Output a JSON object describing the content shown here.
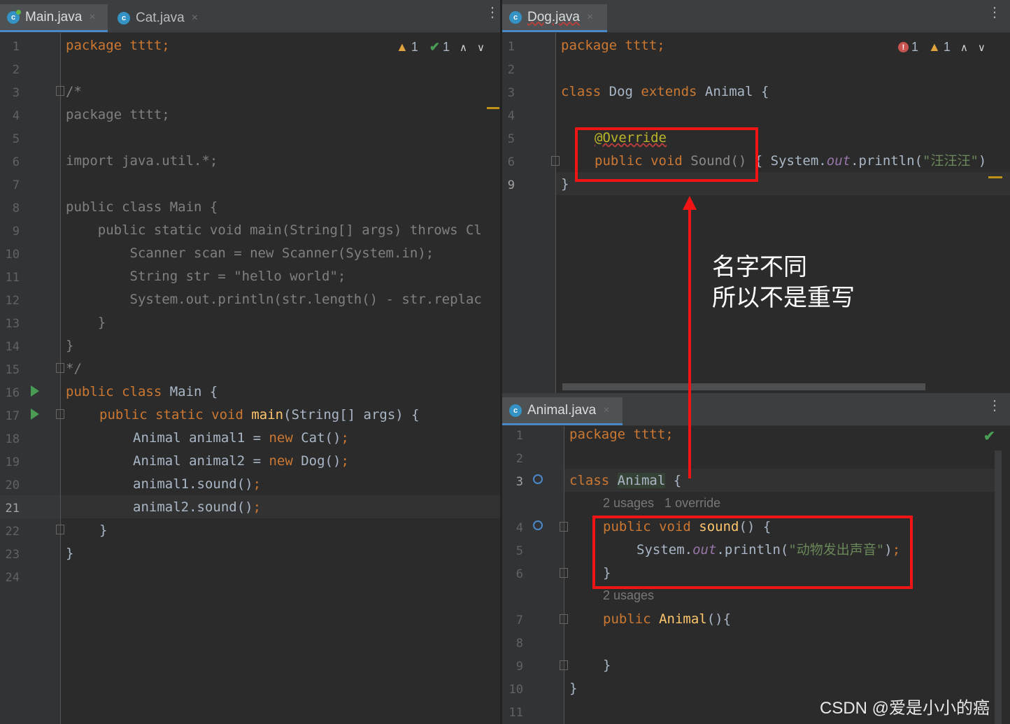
{
  "left_pane": {
    "tabs": [
      {
        "label": "Main.java",
        "close": "×"
      },
      {
        "label": "Cat.java",
        "close": "×"
      }
    ],
    "status": {
      "warnings": "1",
      "checks": "1"
    },
    "line_numbers": [
      "1",
      "2",
      "3",
      "4",
      "5",
      "6",
      "7",
      "8",
      "9",
      "10",
      "11",
      "12",
      "13",
      "14",
      "15",
      "16",
      "17",
      "18",
      "19",
      "20",
      "21",
      "22",
      "23",
      "24"
    ],
    "lines": {
      "l1_kw": "package",
      "l1_rest": " tttt;",
      "l3": "/*",
      "l4": "package tttt;",
      "l6": "import java.util.*;",
      "l8": "public class Main {",
      "l9": "    public static void main(String[] args) throws Cl",
      "l10": "        Scanner scan = new Scanner(System.in);",
      "l11": "        String str = \"hello world\";",
      "l12": "        System.out.println(str.length() - str.replac",
      "l13": "    }",
      "l14": "}",
      "l15": "*/",
      "l16_kw": "public class",
      "l16_rest": " Main {",
      "l17_kw": "public static void",
      "l17_fn": "main",
      "l17_rest": "(String[] args) {",
      "l18_a": "Animal animal1 = ",
      "l18_kw": "new",
      "l18_b": " Cat()",
      "l18_semi": ";",
      "l19_a": "Animal animal2 = ",
      "l19_kw": "new",
      "l19_b": " Dog()",
      "l19_semi": ";",
      "l20_a": "animal1.sound()",
      "l20_semi": ";",
      "l21_a": "animal2.sound()",
      "l21_semi": ";",
      "l22": "}",
      "l23": "}"
    }
  },
  "dog_pane": {
    "tab": {
      "label": "Dog.java",
      "close": "×"
    },
    "status": {
      "errors": "1",
      "warnings": "1"
    },
    "line_numbers": [
      "1",
      "2",
      "3",
      "4",
      "5",
      "6",
      "9"
    ],
    "lines": {
      "l1_kw": "package",
      "l1_rest": " tttt;",
      "l3_kw1": "class",
      "l3_a": " Dog ",
      "l3_kw2": "extends",
      "l3_b": " Animal {",
      "l5": "@Override",
      "l6_kw": "public void",
      "l6_a": " Sound()",
      "l6_b": " { System.",
      "l6_out": "out",
      "l6_c": ".println(",
      "l6_str": "\"汪汪汪\"",
      "l6_d": ")",
      "l9": "}"
    }
  },
  "animal_pane": {
    "tab": {
      "label": "Animal.java",
      "close": "×"
    },
    "line_numbers": [
      "1",
      "2",
      "3",
      "4",
      "5",
      "6",
      "7",
      "8",
      "9",
      "10",
      "11"
    ],
    "hints": {
      "h1": "2 usages   1 override",
      "h2": "2 usages"
    },
    "lines": {
      "l1_kw": "package",
      "l1_rest": " tttt;",
      "l3_kw": "class",
      "l3_name": "Animal",
      "l3_rest": " {",
      "l4_kw": "public void",
      "l4_fn": "sound",
      "l4_rest": "() {",
      "l5_a": "System.",
      "l5_out": "out",
      "l5_b": ".println(",
      "l5_str": "\"动物发出声音\"",
      "l5_c": ")",
      "l5_semi": ";",
      "l6": "}",
      "l7_kw": "public",
      "l7_fn": "Animal",
      "l7_rest": "(){",
      "l9": "}",
      "l10": "}"
    }
  },
  "annotation": {
    "line1": "名字不同",
    "line2": "所以不是重写"
  },
  "watermark": "CSDN @爱是小小的癌"
}
